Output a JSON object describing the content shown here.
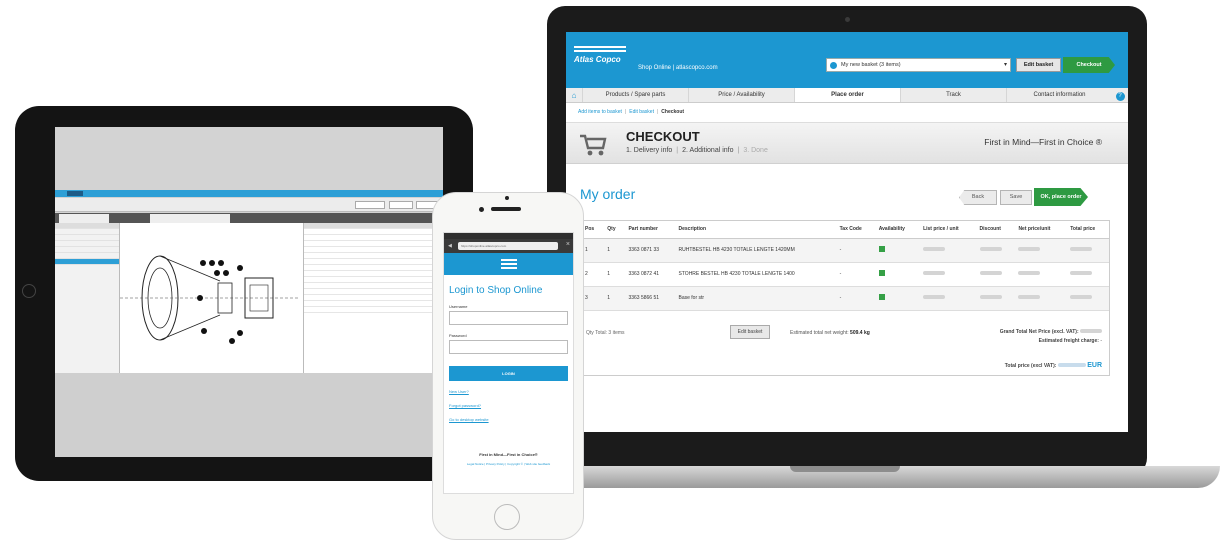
{
  "laptop": {
    "logo": "Atlas Copco",
    "shop_label": "Shop Online | atlascopco.com",
    "basket_select": "My new basket (3 items)",
    "edit_basket": "Edit basket",
    "checkout": "Checkout",
    "nav": [
      "Products / Spare parts",
      "Price / Availability",
      "Place order",
      "Track",
      "Contact information"
    ],
    "nav_active": "Place order",
    "breadcrumb": [
      "Add items to basket",
      "Edit basket",
      "Checkout"
    ],
    "checkout_title": "CHECKOUT",
    "steps": [
      "1. Delivery info",
      "2. Additional info",
      "3. Done"
    ],
    "slogan": "First in Mind—First in Choice ®",
    "my_order": "My order",
    "back": "Back",
    "save": "Save",
    "place_order": "OK, place order",
    "table": {
      "headers": [
        "Pos",
        "Qty",
        "Part number",
        "Description",
        "Tax Code",
        "Availability",
        "List price / unit",
        "Discount",
        "Net price/unit",
        "Total price"
      ],
      "rows": [
        {
          "pos": "1",
          "qty": "1",
          "part": "3363 0871 33",
          "desc": "RUHTBESTEL HB 4230 TOTALE LENGTE 1420MM",
          "tax": "-"
        },
        {
          "pos": "2",
          "qty": "1",
          "part": "3363 0872 41",
          "desc": "STOHRE BESTEL HB 4230 TOTALE LENGTE 1400",
          "tax": "-"
        },
        {
          "pos": "3",
          "qty": "1",
          "part": "3363 5866 51",
          "desc": "Base for str",
          "tax": "-"
        }
      ]
    },
    "qty_total": "Qty Total: 3 items",
    "edit_basket_btn": "Edit basket",
    "net_weight_label": "Estimated total net weight:",
    "net_weight": "509.4 kg",
    "grand_total_label": "Grand Total Net Price (excl. VAT):",
    "freight_label": "Estimated freight charge:",
    "freight_value": "-",
    "total_price_label": "Total price (excl VAT):",
    "currency": "EUR"
  },
  "phone": {
    "url": "https://shoponline.atlascopco.com",
    "title": "Login to Shop Online",
    "username_label": "Username",
    "password_label": "Password",
    "login": "LOGIN",
    "links": [
      "New User?",
      "Forgot password?",
      "Go to desktop website"
    ],
    "footer": "First in Mind—First in Choice®",
    "footer_links": "Legal Notice | Privacy Policy | Copyright © | Web site feedback"
  }
}
